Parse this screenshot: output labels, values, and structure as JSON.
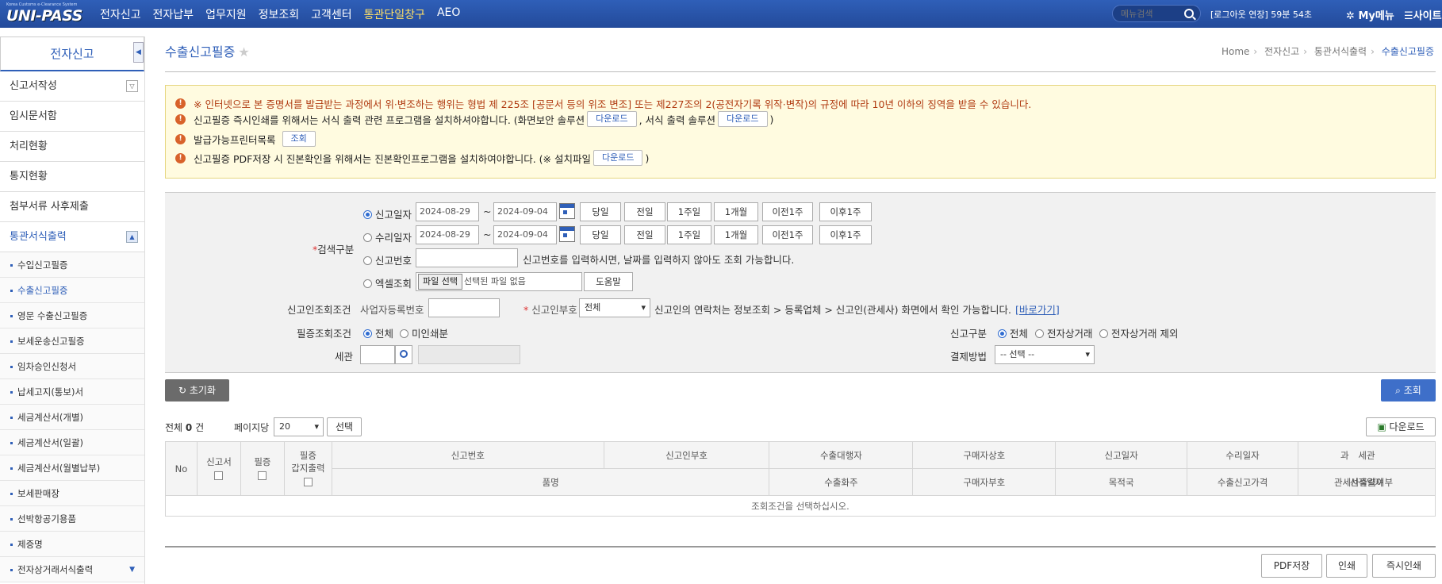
{
  "topnav": {
    "logo_sub": "Korea Customs e-Clearance System",
    "logo": "UNI-PASS",
    "menus": [
      "전자신고",
      "전자납부",
      "업무지원",
      "정보조회",
      "고객센터",
      "통관단일창구",
      "AEO"
    ],
    "search_placeholder": "메뉴검색",
    "logout": "[로그아웃 연장] 59분 54초",
    "mymenu": "My메뉴",
    "sitemap": "사이트"
  },
  "sidebar": {
    "title": "전자신고",
    "items": [
      "신고서작성",
      "임시문서함",
      "처리현황",
      "통지현황",
      "첨부서류 사후제출",
      "통관서식출력"
    ],
    "subitems": [
      "수입신고필증",
      "수출신고필증",
      "영문 수출신고필증",
      "보세운송신고필증",
      "임차승인신청서",
      "납세고지(통보)서",
      "세금계산서(개별)",
      "세금계산서(일괄)",
      "세금계산서(월별납부)",
      "보세판매장",
      "선박항공기용품",
      "제증명",
      "전자상거래서식출력"
    ]
  },
  "page": {
    "title": "수출신고필증",
    "breadcrumb": [
      "Home",
      "전자신고",
      "통관서식출력",
      "수출신고필증"
    ]
  },
  "notice": {
    "line1": "※ 인터넷으로 본 증명서를 발급받는 과정에서 위·변조하는 행위는 형법 제 225조 [공문서 등의 위조 변조] 또는 제227조의 2(공전자기록 위작·변작)의 규정에 따라 10년 이하의 징역을 받을 수 있습니다.",
    "line2a": "신고필증 즉시인쇄를 위해서는 서식 출력 관련 프로그램을 설치하셔야합니다. (화면보안 솔루션",
    "line2b": ", 서식 출력 솔루션",
    "line2c": ")",
    "download": "다운로드",
    "line3": "발급가능프린터목록",
    "inquiry": "조회",
    "line4a": "신고필증 PDF저장 시 진본확인을 위해서는 진본확인프로그램을 설치하여야합니다. (※ 설치파일",
    "line4b": ")"
  },
  "search": {
    "label_type": "검색구분",
    "decl_date": "신고일자",
    "accept_date": "수리일자",
    "decl_no": "신고번호",
    "excel": "엑셀조회",
    "date_from": "2024-08-29",
    "date_to": "2024-09-04",
    "tilde": "~",
    "quick": [
      "당일",
      "전일",
      "1주일",
      "1개월",
      "이전1주",
      "이후1주"
    ],
    "decl_no_hint": "신고번호를 입력하시면, 날짜를 입력하지 않아도 조회 가능합니다.",
    "file_btn": "파일 선택",
    "file_none": "선택된 파일 없음",
    "help": "도움말",
    "label_declarant": "신고인조회조건",
    "biz_no": "사업자등록번호",
    "declarant_mark": "신고인부호",
    "declarant_select": "전체",
    "declarant_hint": "신고인의 연락처는 정보조회 > 등록업체 > 신고인(관세사) 화면에서 확인 가능합니다.",
    "goto": "[바로가기]",
    "label_cert": "필증조회조건",
    "cert_all": "전체",
    "cert_unprinted": "미인쇄분",
    "label_customs": "세관",
    "label_decl_type": "신고구분",
    "dt_all": "전체",
    "dt_ecom": "전자상거래",
    "dt_ex_ecom": "전자상거래 제외",
    "label_payment": "결제방법",
    "payment_select": "-- 선택 --",
    "reset": "초기화",
    "search": "조회"
  },
  "result": {
    "total_prefix": "전체",
    "total_count": "0",
    "total_suffix": "건",
    "per_page_label": "페이지당",
    "per_page": "20",
    "select": "선택",
    "download": "다운로드",
    "headers": {
      "no": "No",
      "decl": "신고서",
      "cert": "필증",
      "cert_a": "필증",
      "cert_b": "갑지출력",
      "row1": [
        "신고번호",
        "신고인부호",
        "수출대행자",
        "구매자상호",
        "신고일자",
        "수리일자",
        "세관",
        "과"
      ],
      "row2": [
        "품명",
        "수출화주",
        "구매자부호",
        "목적국",
        "수출신고가격",
        "선적일자",
        "관세사출력여부"
      ]
    },
    "empty": "조회조건을 선택하십시오."
  },
  "footer": {
    "pdf": "PDF저장",
    "print": "인쇄",
    "instant_print": "즉시인쇄"
  }
}
